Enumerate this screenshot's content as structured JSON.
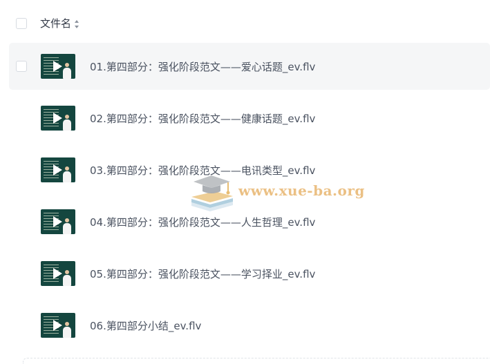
{
  "header": {
    "column_title": "文件名",
    "sort_icon": "sort-updown-icon"
  },
  "files": [
    {
      "name": "01.第四部分：强化阶段范文——爱心话题_ev.flv",
      "thumbnail_icon": "video-thumbnail-icon",
      "selected_hover": true
    },
    {
      "name": "02.第四部分：强化阶段范文——健康话题_ev.flv",
      "thumbnail_icon": "video-thumbnail-icon",
      "selected_hover": false
    },
    {
      "name": "03.第四部分：强化阶段范文——电讯类型_ev.flv",
      "thumbnail_icon": "video-thumbnail-icon",
      "selected_hover": false
    },
    {
      "name": "04.第四部分：强化阶段范文——人生哲理_ev.flv",
      "thumbnail_icon": "video-thumbnail-icon",
      "selected_hover": false
    },
    {
      "name": "05.第四部分：强化阶段范文——学习择业_ev.flv",
      "thumbnail_icon": "video-thumbnail-icon",
      "selected_hover": false
    },
    {
      "name": "06.第四部分小结_ev.flv",
      "thumbnail_icon": "video-thumbnail-icon",
      "selected_hover": false
    }
  ],
  "watermark": {
    "text": "www.xue-ba.org",
    "icon": "graduation-cap-books-icon",
    "color": "#e7b36a"
  },
  "colors": {
    "row_hover": "#f5f6f7",
    "thumbnail_bg": "#14463f",
    "text": "#4a5260"
  }
}
